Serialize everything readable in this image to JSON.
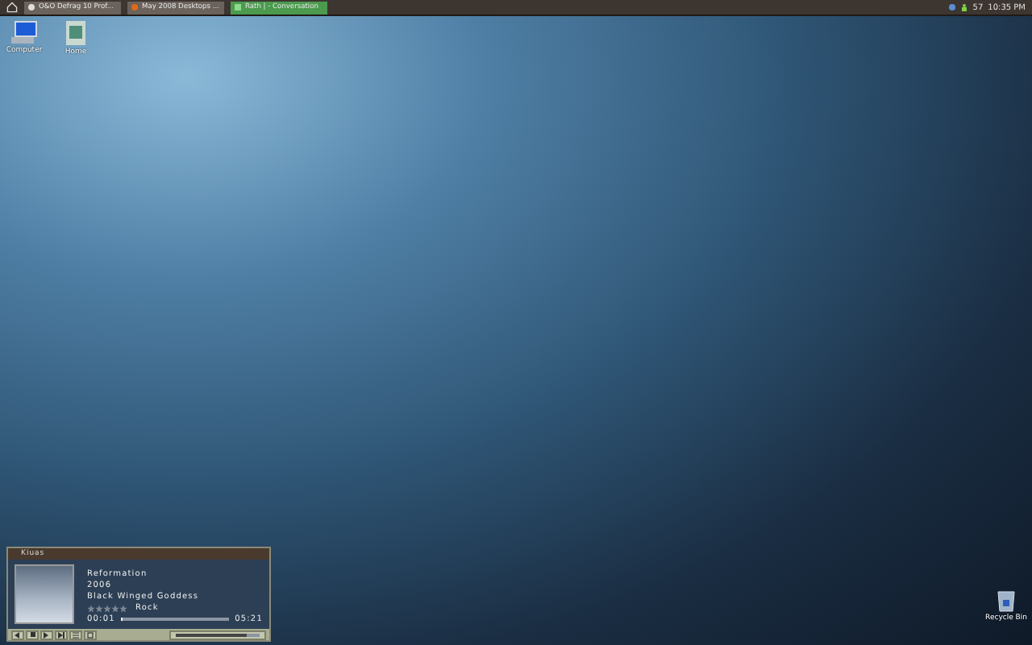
{
  "taskbar": {
    "tasks": [
      {
        "label": "O&O Defrag 10 Prof...",
        "kind": "disk",
        "selected": false
      },
      {
        "label": "May 2008 Desktops ...",
        "kind": "browser",
        "selected": false
      },
      {
        "label": "Rath | - Conversation",
        "kind": "chat",
        "selected": true
      }
    ],
    "tray": {
      "counter": "57",
      "clock": "10:35 PM"
    }
  },
  "desktop_icons": [
    {
      "label": "Computer",
      "kind": "computer"
    },
    {
      "label": "Home",
      "kind": "home"
    }
  ],
  "recycle_bin": {
    "label": "Recycle Bin"
  },
  "player": {
    "title": "Kiuas",
    "album": "Reformation",
    "year": "2006",
    "track": "Black Winged Goddess",
    "stars": 0,
    "genre": "Rock",
    "elapsed": "00:01",
    "duration": "05:21",
    "progress": {
      "level": 0.01
    },
    "volume": {
      "level": 0.85
    }
  }
}
